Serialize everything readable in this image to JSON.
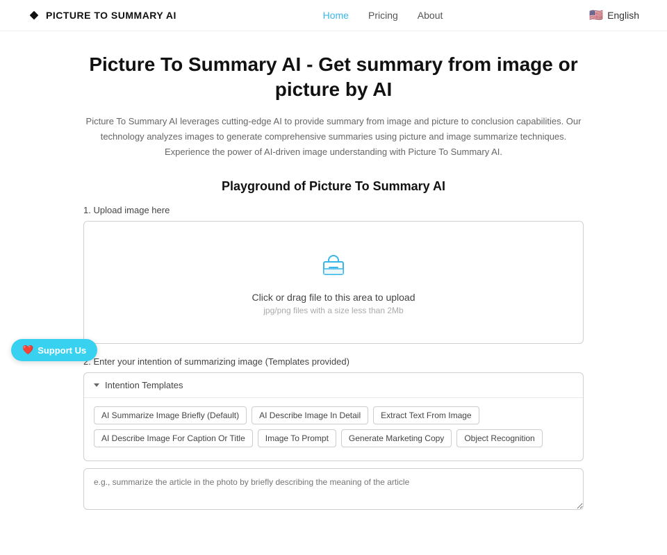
{
  "header": {
    "logo_text": "PICTURE TO SUMMARY AI",
    "nav": [
      {
        "label": "Home",
        "active": true
      },
      {
        "label": "Pricing",
        "active": false
      },
      {
        "label": "About",
        "active": false
      }
    ],
    "lang_label": "English"
  },
  "hero": {
    "title": "Picture To Summary AI - Get summary from image or picture by AI",
    "description": "Picture To Summary AI leverages cutting-edge AI to provide summary from image and picture to conclusion capabilities. Our technology analyzes images to generate comprehensive summaries using picture and image summarize techniques. Experience the power of AI-driven image understanding with Picture To Summary AI.",
    "playground_title": "Playground of Picture To Summary AI"
  },
  "upload": {
    "section_label": "1. Upload image here",
    "main_text": "Click or drag file to this area to upload",
    "sub_text": "jpg/png files with a size less than 2Mb"
  },
  "templates": {
    "section_label": "2. Enter your intention of summarizing image (Templates provided)",
    "header_label": "Intention Templates",
    "tags_row1": [
      "AI Summarize Image Briefly (Default)",
      "AI Describe Image In Detail",
      "Extract Text From Image"
    ],
    "tags_row2": [
      "AI Describe Image For Caption Or Title",
      "Image To Prompt",
      "Generate Marketing Copy",
      "Object Recognition"
    ]
  },
  "textarea": {
    "placeholder": "e.g., summarize the article in the photo by briefly describing the meaning of the article"
  },
  "support": {
    "label": "Support Us"
  }
}
